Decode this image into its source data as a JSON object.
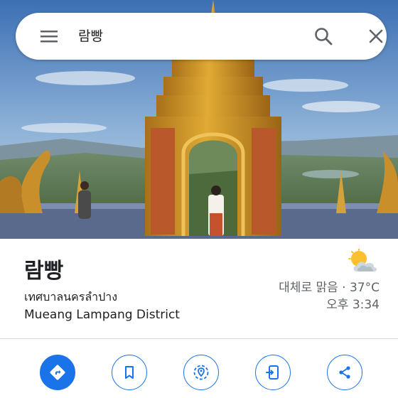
{
  "search": {
    "query": "람빵",
    "menu_icon": "hamburger-menu-icon",
    "search_icon": "search-icon",
    "close_icon": "close-icon"
  },
  "hero": {
    "image": "temple-gate-photo"
  },
  "place": {
    "title": "람빵",
    "local_name": "เทศบาลนครลำปาง",
    "district": "Mueang Lampang District"
  },
  "weather": {
    "condition": "대체로 맑음 · 37°C",
    "time": "오후 3:34",
    "icon": "partly-cloudy-icon"
  },
  "actions": [
    {
      "icon": "directions-icon",
      "style": "filled"
    },
    {
      "icon": "bookmark-icon",
      "style": "outline"
    },
    {
      "icon": "nearby-icon",
      "style": "outline"
    },
    {
      "icon": "send-to-phone-icon",
      "style": "outline"
    },
    {
      "icon": "share-icon",
      "style": "outline"
    }
  ],
  "colors": {
    "accent": "#1a73e8",
    "text_primary": "#202124",
    "text_secondary": "#5f6368",
    "temple_gold": "#d9a02a"
  }
}
